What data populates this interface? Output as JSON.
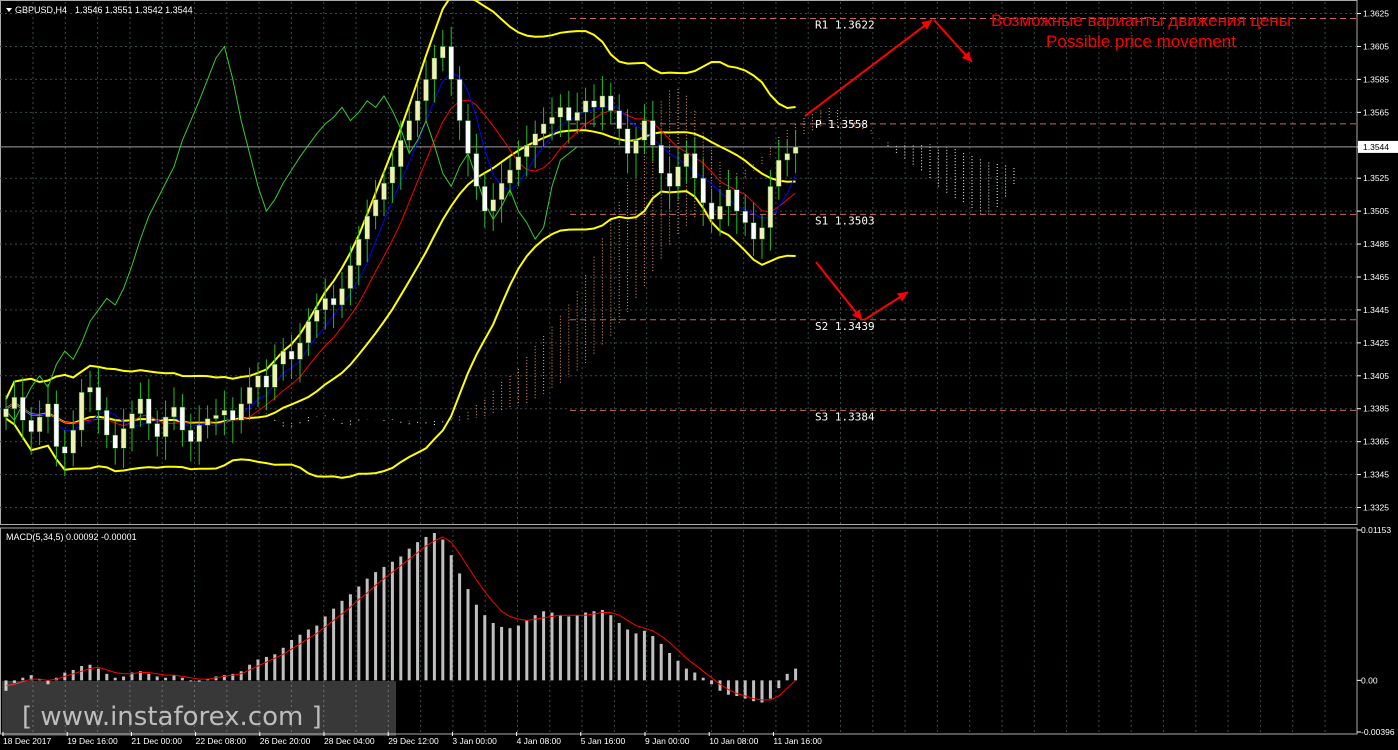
{
  "header": {
    "symbol_label": "GBPUSD,H4",
    "ohlc": "1.3546 1.3551 1.3542 1.3544"
  },
  "annotation": {
    "line1": "Возможные варианты движения цены",
    "line2": "Possible price movement"
  },
  "watermark": "[ www.instaforex.com ]",
  "colors": {
    "background": "#000000",
    "grid": "#3a4a4a",
    "bull_candle": "#f0f0b0",
    "bear_candle": "#ffffff",
    "wick": "#22c022",
    "bollinger": "#ffff00",
    "kijun": "#ff0000",
    "tenkan": "#0000ff",
    "chikou": "#32cd32",
    "cloud": "#f4a460",
    "cloud_white": "#ffffff",
    "level_line": "#c86464",
    "arrow": "#ff0000",
    "macd_hist": "#c0c0c0",
    "macd_signal": "#ff0000"
  },
  "chart_data": [
    {
      "type": "candlestick",
      "symbol": "GBPUSD",
      "timeframe": "H4",
      "current_price": 1.3544,
      "ylim": [
        1.3315,
        1.3632
      ],
      "y_ticks": [
        "1.3625",
        "1.3605",
        "1.3585",
        "1.3565",
        "1.3544",
        "1.3525",
        "1.3505",
        "1.3485",
        "1.3465",
        "1.3445",
        "1.3425",
        "1.3405",
        "1.3385",
        "1.3365",
        "1.3345",
        "1.3325"
      ],
      "x_ticks": [
        "18 Dec 2017",
        "19 Dec 16:00",
        "21 Dec 00:00",
        "22 Dec 08:00",
        "26 Dec 20:00",
        "28 Dec 04:00",
        "29 Dec 12:00",
        "3 Jan 00:00",
        "4 Jan 08:00",
        "5 Jan 16:00",
        "9 Jan 00:00",
        "10 Jan 08:00",
        "11 Jan 16:00"
      ],
      "pivot_levels": [
        {
          "name": "R1",
          "value": "1.3622"
        },
        {
          "name": "P",
          "value": "1.3558"
        },
        {
          "name": "S1",
          "value": "1.3503"
        },
        {
          "name": "S2",
          "value": "1.3439"
        },
        {
          "name": "S3",
          "value": "1.3384"
        }
      ],
      "close_series": [
        1.3385,
        1.3392,
        1.3378,
        1.3371,
        1.338,
        1.3388,
        1.3362,
        1.3358,
        1.3372,
        1.3395,
        1.3398,
        1.3384,
        1.3369,
        1.3361,
        1.3373,
        1.3382,
        1.3391,
        1.3376,
        1.3368,
        1.338,
        1.3386,
        1.3372,
        1.3365,
        1.3375,
        1.3379,
        1.3381,
        1.3384,
        1.3378,
        1.3388,
        1.3398,
        1.3405,
        1.3398,
        1.3412,
        1.342,
        1.3415,
        1.3425,
        1.3438,
        1.3445,
        1.3452,
        1.3448,
        1.3458,
        1.3472,
        1.3488,
        1.3502,
        1.3512,
        1.3522,
        1.3532,
        1.3548,
        1.356,
        1.3572,
        1.3585,
        1.3598,
        1.3605,
        1.3585,
        1.356,
        1.354,
        1.352,
        1.3505,
        1.3512,
        1.3522,
        1.353,
        1.3538,
        1.3545,
        1.3552,
        1.3558,
        1.3562,
        1.3568,
        1.356,
        1.3565,
        1.3572,
        1.3568,
        1.3575,
        1.3566,
        1.3555,
        1.354,
        1.3548,
        1.356,
        1.3545,
        1.3528,
        1.352,
        1.3532,
        1.354,
        1.3525,
        1.351,
        1.35,
        1.3508,
        1.3518,
        1.3505,
        1.3498,
        1.3488,
        1.3495,
        1.352,
        1.3536,
        1.354,
        1.3544
      ]
    },
    {
      "type": "bar",
      "indicator": "MACD(5,34,5)",
      "label": "MACD(5,34,5) 0.00092 -0.00001",
      "main_value": 0.00092,
      "signal_value": -1e-05,
      "ylim": [
        -0.00396,
        0.01153
      ],
      "y_ticks": [
        "0.01153",
        "0.00",
        "-0.00396"
      ],
      "histogram": [
        -0.0008,
        -0.0002,
        0.0002,
        0.0004,
        0.0001,
        -0.0003,
        0.0002,
        0.0006,
        0.0008,
        0.0011,
        0.0012,
        0.0009,
        0.0005,
        0.0002,
        0.0003,
        0.0006,
        0.0007,
        0.0005,
        0.0003,
        0.0002,
        0.0004,
        0.0002,
        0.0,
        -0.0001,
        0.0001,
        0.0003,
        0.0004,
        0.0005,
        0.0007,
        0.0012,
        0.0016,
        0.0018,
        0.002,
        0.0025,
        0.0031,
        0.0035,
        0.0039,
        0.0042,
        0.0049,
        0.0055,
        0.0061,
        0.0066,
        0.0072,
        0.0078,
        0.0083,
        0.0087,
        0.0091,
        0.0095,
        0.0101,
        0.0106,
        0.011,
        0.0113,
        0.0108,
        0.0096,
        0.0082,
        0.007,
        0.0058,
        0.005,
        0.0044,
        0.0041,
        0.004,
        0.0042,
        0.0046,
        0.005,
        0.0053,
        0.0052,
        0.005,
        0.0049,
        0.005,
        0.0052,
        0.0053,
        0.0054,
        0.005,
        0.0044,
        0.0039,
        0.0036,
        0.0038,
        0.0034,
        0.0028,
        0.0021,
        0.0015,
        0.0009,
        0.0006,
        0.0002,
        -0.0003,
        -0.0008,
        -0.0011,
        -0.0012,
        -0.0014,
        -0.0016,
        -0.0017,
        -0.0014,
        -0.0006,
        0.0005,
        0.0009
      ],
      "signal": [
        -0.0004,
        -0.0003,
        -0.0001,
        0.0001,
        0.0001,
        0.0,
        0.0001,
        0.0003,
        0.0005,
        0.0007,
        0.0009,
        0.001,
        0.0008,
        0.0006,
        0.0005,
        0.0005,
        0.0006,
        0.0006,
        0.0005,
        0.0004,
        0.0004,
        0.0003,
        0.0002,
        0.0001,
        0.0001,
        0.0002,
        0.0003,
        0.0004,
        0.0005,
        0.0008,
        0.0011,
        0.0014,
        0.0017,
        0.002,
        0.0024,
        0.0028,
        0.0032,
        0.0036,
        0.0041,
        0.0046,
        0.0051,
        0.0056,
        0.0062,
        0.0067,
        0.0073,
        0.0078,
        0.0083,
        0.0088,
        0.0093,
        0.0098,
        0.0103,
        0.0107,
        0.011,
        0.0106,
        0.0097,
        0.0087,
        0.0077,
        0.0068,
        0.006,
        0.0053,
        0.0049,
        0.0047,
        0.0046,
        0.0047,
        0.0048,
        0.0049,
        0.005,
        0.005,
        0.005,
        0.005,
        0.0051,
        0.0052,
        0.0052,
        0.005,
        0.0046,
        0.0042,
        0.004,
        0.0038,
        0.0034,
        0.0029,
        0.0023,
        0.0017,
        0.0012,
        0.0007,
        0.0002,
        -0.0003,
        -0.0007,
        -0.001,
        -0.0012,
        -0.0014,
        -0.0015,
        -0.0015,
        -0.0012,
        -0.0006,
        -0.0
      ]
    }
  ]
}
